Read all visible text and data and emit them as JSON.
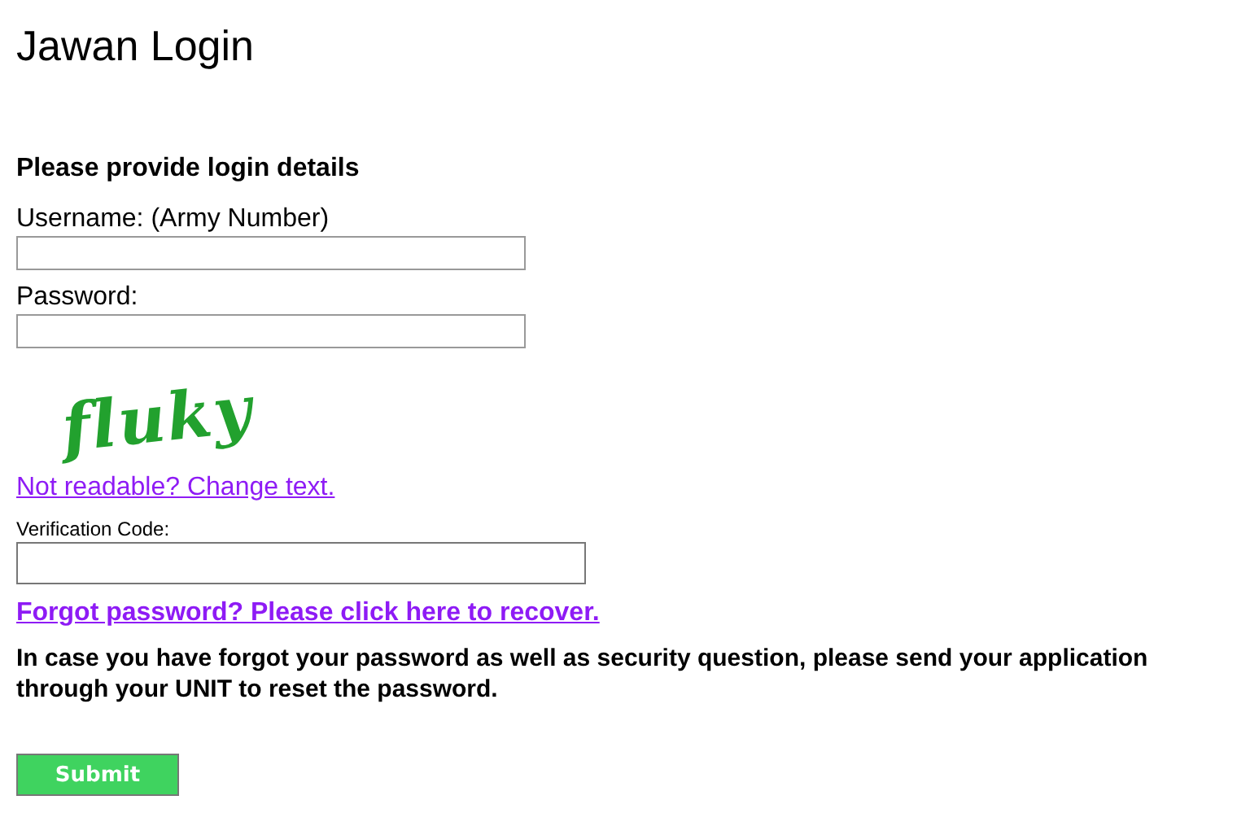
{
  "title": "Jawan Login",
  "heading": "Please provide login details",
  "fields": [
    {
      "label": "Username: (Army Number)"
    },
    {
      "label": "Password:"
    }
  ],
  "captcha": {
    "text": "fluky",
    "link": "Not readable? Change text."
  },
  "verification": {
    "label": "Verification Code:"
  },
  "forgot_link": "Forgot password? Please click here to recover.",
  "notice": "In case you have forgot your password as well as security question, please send your application through your UNIT to reset the password.",
  "submit": "Submit"
}
